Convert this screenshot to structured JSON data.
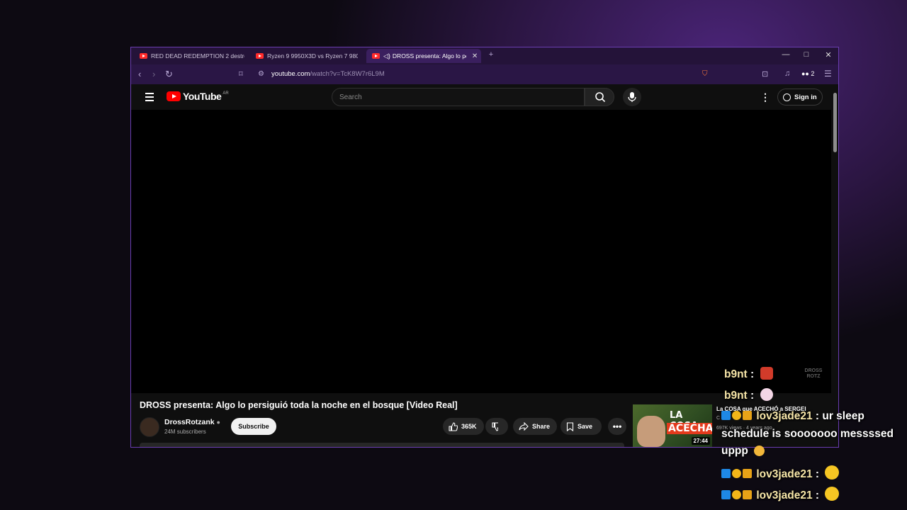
{
  "browser": {
    "tabs": [
      {
        "label": "RED DEAD REDEMPTION 2 destrozó"
      },
      {
        "label": "Ryzen 9 9950X3D vs Ryzen 7 9800X3D"
      },
      {
        "label": "DROSS presenta: Algo lo persigui"
      }
    ],
    "url_host": "youtube.com",
    "url_path": "/watch?v=TcK8W7r6L9M",
    "extension_count": "2"
  },
  "youtube": {
    "logo_text": "YouTube",
    "country_code": "AR",
    "search_placeholder": "Search",
    "signin_label": "Sign in"
  },
  "video": {
    "title": "DROSS presenta: Algo lo persiguió toda la noche en el bosque [Video Real]",
    "channel_name": "DrossRotzank",
    "subscribers": "24M subscribers",
    "subscribe_label": "Subscribe",
    "likes": "365K",
    "share_label": "Share",
    "save_label": "Save"
  },
  "recommendation": {
    "title": "La COSA que ACECHÓ a SERGEI",
    "channel": "C",
    "meta": "697K views · 4 years ago",
    "thumb_line1": "LA COSA",
    "thumb_line2": "ACECHA",
    "duration": "27:44"
  },
  "chat": [
    {
      "user": "b9nt",
      "text": ""
    },
    {
      "user": "b9nt",
      "text": ""
    },
    {
      "user": "lov3jade21",
      "text": ": ur sleep"
    },
    {
      "text": "schedule is sooooooo messssed"
    },
    {
      "text": "uppp"
    },
    {
      "user": "lov3jade21",
      "text": ""
    },
    {
      "user": "lov3jade21",
      "text": ""
    }
  ],
  "colors": {
    "accent_purple": "#6a3db0",
    "youtube_red": "#ff0000"
  }
}
